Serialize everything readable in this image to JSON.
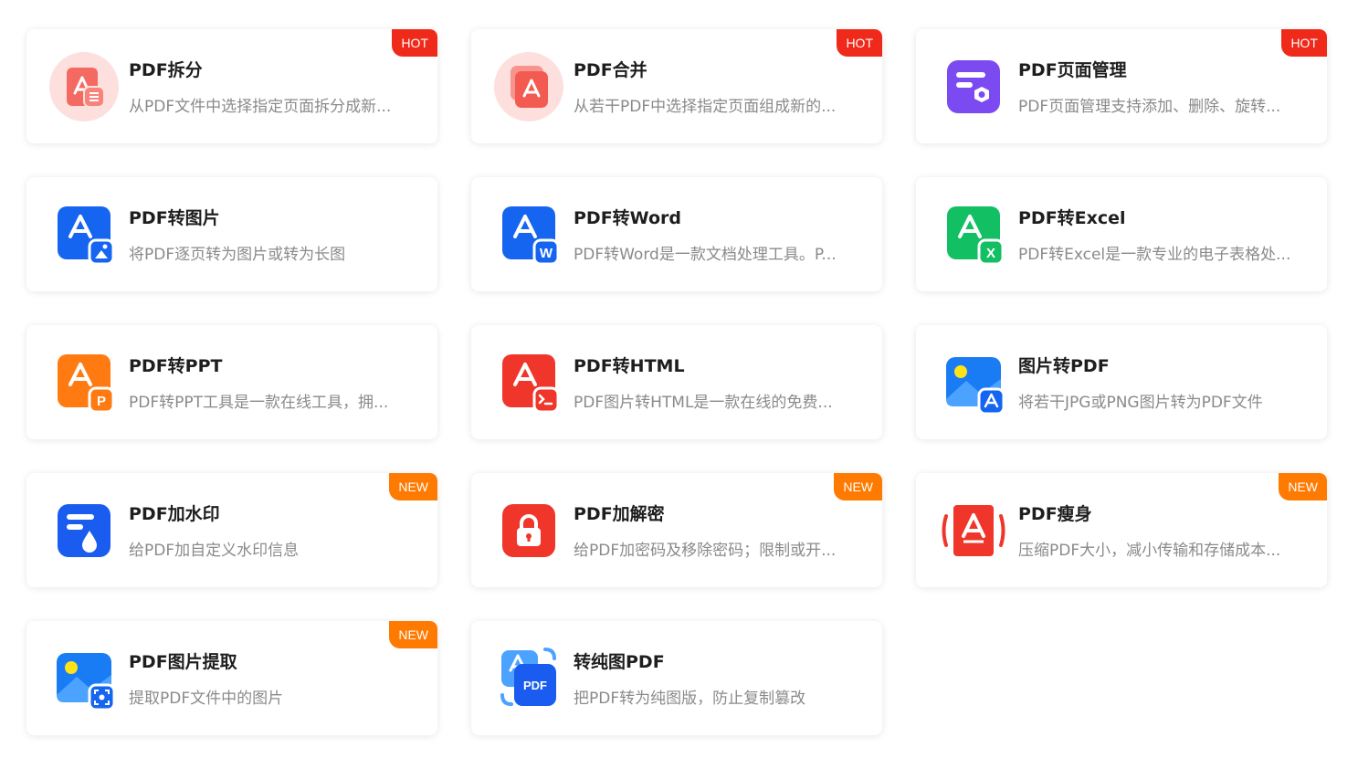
{
  "colors": {
    "hot_badge": "#f02a1a",
    "new_badge": "#ff7a00",
    "title": "#1e1e1e",
    "description": "#8a8a8a"
  },
  "tools": [
    {
      "title": "PDF拆分",
      "desc": "从PDF文件中选择指定页面拆分成新...",
      "badge": "HOT",
      "icon": "pdf-split-icon"
    },
    {
      "title": "PDF合并",
      "desc": "从若干PDF中选择指定页面组成新的...",
      "badge": "HOT",
      "icon": "pdf-merge-icon"
    },
    {
      "title": "PDF页面管理",
      "desc": "PDF页面管理支持添加、删除、旋转...",
      "badge": "HOT",
      "icon": "page-manage-icon"
    },
    {
      "title": "PDF转图片",
      "desc": "将PDF逐页转为图片或转为长图",
      "badge": "",
      "icon": "pdf-to-image-icon"
    },
    {
      "title": "PDF转Word",
      "desc": "PDF转Word是一款文档处理工具。P...",
      "badge": "",
      "icon": "pdf-to-word-icon"
    },
    {
      "title": "PDF转Excel",
      "desc": "PDF转Excel是一款专业的电子表格处...",
      "badge": "",
      "icon": "pdf-to-excel-icon"
    },
    {
      "title": "PDF转PPT",
      "desc": "PDF转PPT工具是一款在线工具，拥...",
      "badge": "",
      "icon": "pdf-to-ppt-icon"
    },
    {
      "title": "PDF转HTML",
      "desc": "PDF图片转HTML是一款在线的免费...",
      "badge": "",
      "icon": "pdf-to-html-icon"
    },
    {
      "title": "图片转PDF",
      "desc": "将若干JPG或PNG图片转为PDF文件",
      "badge": "",
      "icon": "image-to-pdf-icon"
    },
    {
      "title": "PDF加水印",
      "desc": "给PDF加自定义水印信息",
      "badge": "NEW",
      "icon": "watermark-icon"
    },
    {
      "title": "PDF加解密",
      "desc": "给PDF加密码及移除密码；限制或开...",
      "badge": "NEW",
      "icon": "lock-icon"
    },
    {
      "title": "PDF瘦身",
      "desc": "压缩PDF大小，减小传输和存储成本...",
      "badge": "NEW",
      "icon": "compress-icon"
    },
    {
      "title": "PDF图片提取",
      "desc": "提取PDF文件中的图片",
      "badge": "NEW",
      "icon": "extract-image-icon"
    },
    {
      "title": "转纯图PDF",
      "desc": "把PDF转为纯图版，防止复制篡改",
      "badge": "",
      "icon": "pure-image-pdf-icon"
    }
  ]
}
